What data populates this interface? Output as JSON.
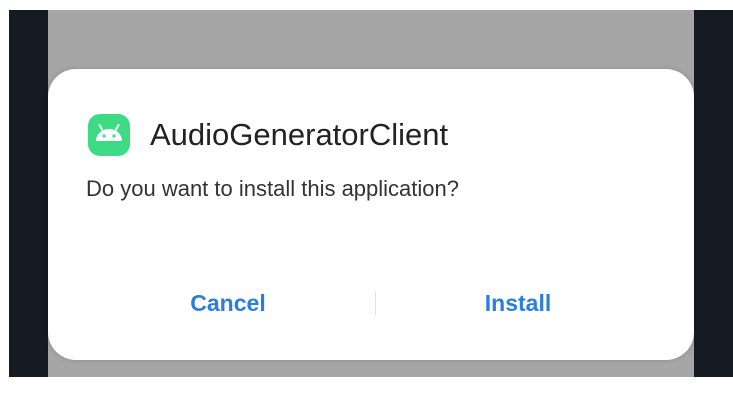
{
  "dialog": {
    "app_name": "AudioGeneratorClient",
    "app_icon": "android-robot-icon",
    "message": "Do you want to install this application?",
    "cancel_label": "Cancel",
    "install_label": "Install"
  },
  "colors": {
    "accent": "#2a7ee0",
    "icon_background": "#3ddc84",
    "scrim": "#a6a6a6",
    "frame": "#151b22"
  }
}
